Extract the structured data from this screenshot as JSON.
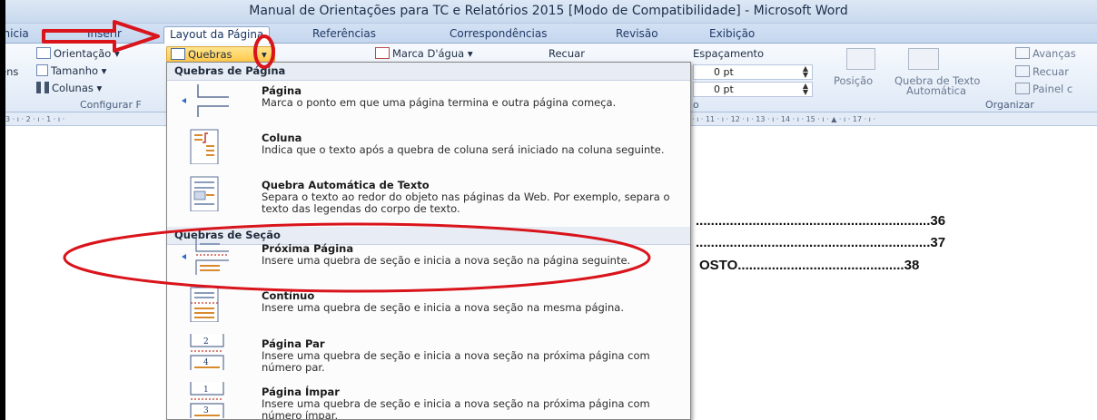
{
  "window": {
    "title": "Manual de Orientações para TC e Relatórios 2015 [Modo de Compatibilidade]  -  Microsoft Word"
  },
  "tabs": [
    {
      "label": "Inicia"
    },
    {
      "label": "Inserir"
    },
    {
      "label": "Layout da Página"
    },
    {
      "label": "Referências"
    },
    {
      "label": "Correspondências"
    },
    {
      "label": "Revisão"
    },
    {
      "label": "Exibição"
    }
  ],
  "ribbon": {
    "orientacao": "Orientação",
    "tamanho": "Tamanho",
    "colunas": "Colunas",
    "margens_partial": "ens",
    "quebras": "Quebras",
    "marca_dagua": "Marca D'água",
    "recuar_col": "Recuar",
    "espacamento": "Espaçamento",
    "espacamento_antes": "0 pt",
    "espacamento_depois": "0 pt",
    "posicao": "Posição",
    "quebra_texto": "Quebra de Texto",
    "automatica": "Automática",
    "avancar": "Avanças",
    "recuar": "Recuar",
    "painel": "Painel c",
    "group_configurar": "Configurar F",
    "group_organizar": "Organizar",
    "paragraph_partial": "o"
  },
  "ruler": {
    "left_marks": "3 · ı · 2 · ı · 1 · ı ·",
    "right_marks": "· ı · 11 · ı · 12 · ı · 13 · ı · 14 · ı · 15 · ı · ▲ · ı · 17 · ı ·"
  },
  "document": {
    "toc": [
      {
        "text": "..............................................................36"
      },
      {
        "text": "..............................................................37"
      },
      {
        "text": "OSTO............................................38"
      }
    ]
  },
  "menu": {
    "section_page": "Quebras de Página",
    "section_section": "Quebras de Seção",
    "items": [
      {
        "title": "Página",
        "desc": "Marca o ponto em que uma página termina e outra página começa.",
        "icon": "page-break-icon"
      },
      {
        "title": "Coluna",
        "desc": "Indica que o texto após a quebra de coluna será iniciado na coluna seguinte.",
        "icon": "column-break-icon"
      },
      {
        "title": "Quebra Automática de Texto",
        "desc": "Separa o texto ao redor do objeto nas páginas da Web. Por exemplo, separa o texto das legendas do corpo de texto.",
        "icon": "text-wrapping-break-icon"
      },
      {
        "title": "Próxima Página",
        "desc": "Insere uma quebra de seção e inicia a nova seção na página seguinte.",
        "icon": "next-page-section-icon"
      },
      {
        "title": "Contínuo",
        "desc": "Insere uma quebra de seção e inicia a nova seção na mesma página.",
        "icon": "continuous-section-icon"
      },
      {
        "title": "Página Par",
        "desc": "Insere uma quebra de seção e inicia a nova seção na próxima página com número par.",
        "icon": "even-page-section-icon"
      },
      {
        "title": "Página Ímpar",
        "desc": "Insere uma quebra de seção e inicia a nova seção na próxima página com número ímpar.",
        "icon": "odd-page-section-icon"
      }
    ]
  },
  "colors": {
    "annotation_red": "#d9141b",
    "quebras_highlight": "#ffd05a",
    "ribbon_bg": "#dfe9f6"
  }
}
